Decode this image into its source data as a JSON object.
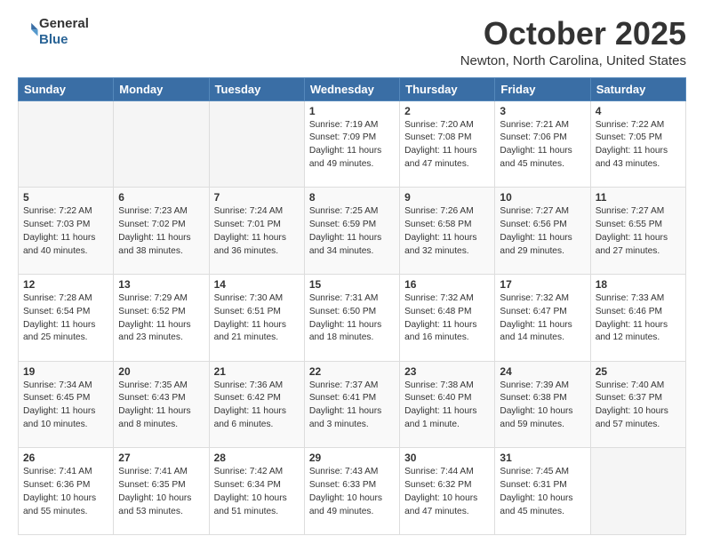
{
  "header": {
    "logo_general": "General",
    "logo_blue": "Blue",
    "month": "October 2025",
    "location": "Newton, North Carolina, United States"
  },
  "weekdays": [
    "Sunday",
    "Monday",
    "Tuesday",
    "Wednesday",
    "Thursday",
    "Friday",
    "Saturday"
  ],
  "weeks": [
    [
      {
        "day": "",
        "info": ""
      },
      {
        "day": "",
        "info": ""
      },
      {
        "day": "",
        "info": ""
      },
      {
        "day": "1",
        "info": "Sunrise: 7:19 AM\nSunset: 7:09 PM\nDaylight: 11 hours\nand 49 minutes."
      },
      {
        "day": "2",
        "info": "Sunrise: 7:20 AM\nSunset: 7:08 PM\nDaylight: 11 hours\nand 47 minutes."
      },
      {
        "day": "3",
        "info": "Sunrise: 7:21 AM\nSunset: 7:06 PM\nDaylight: 11 hours\nand 45 minutes."
      },
      {
        "day": "4",
        "info": "Sunrise: 7:22 AM\nSunset: 7:05 PM\nDaylight: 11 hours\nand 43 minutes."
      }
    ],
    [
      {
        "day": "5",
        "info": "Sunrise: 7:22 AM\nSunset: 7:03 PM\nDaylight: 11 hours\nand 40 minutes."
      },
      {
        "day": "6",
        "info": "Sunrise: 7:23 AM\nSunset: 7:02 PM\nDaylight: 11 hours\nand 38 minutes."
      },
      {
        "day": "7",
        "info": "Sunrise: 7:24 AM\nSunset: 7:01 PM\nDaylight: 11 hours\nand 36 minutes."
      },
      {
        "day": "8",
        "info": "Sunrise: 7:25 AM\nSunset: 6:59 PM\nDaylight: 11 hours\nand 34 minutes."
      },
      {
        "day": "9",
        "info": "Sunrise: 7:26 AM\nSunset: 6:58 PM\nDaylight: 11 hours\nand 32 minutes."
      },
      {
        "day": "10",
        "info": "Sunrise: 7:27 AM\nSunset: 6:56 PM\nDaylight: 11 hours\nand 29 minutes."
      },
      {
        "day": "11",
        "info": "Sunrise: 7:27 AM\nSunset: 6:55 PM\nDaylight: 11 hours\nand 27 minutes."
      }
    ],
    [
      {
        "day": "12",
        "info": "Sunrise: 7:28 AM\nSunset: 6:54 PM\nDaylight: 11 hours\nand 25 minutes."
      },
      {
        "day": "13",
        "info": "Sunrise: 7:29 AM\nSunset: 6:52 PM\nDaylight: 11 hours\nand 23 minutes."
      },
      {
        "day": "14",
        "info": "Sunrise: 7:30 AM\nSunset: 6:51 PM\nDaylight: 11 hours\nand 21 minutes."
      },
      {
        "day": "15",
        "info": "Sunrise: 7:31 AM\nSunset: 6:50 PM\nDaylight: 11 hours\nand 18 minutes."
      },
      {
        "day": "16",
        "info": "Sunrise: 7:32 AM\nSunset: 6:48 PM\nDaylight: 11 hours\nand 16 minutes."
      },
      {
        "day": "17",
        "info": "Sunrise: 7:32 AM\nSunset: 6:47 PM\nDaylight: 11 hours\nand 14 minutes."
      },
      {
        "day": "18",
        "info": "Sunrise: 7:33 AM\nSunset: 6:46 PM\nDaylight: 11 hours\nand 12 minutes."
      }
    ],
    [
      {
        "day": "19",
        "info": "Sunrise: 7:34 AM\nSunset: 6:45 PM\nDaylight: 11 hours\nand 10 minutes."
      },
      {
        "day": "20",
        "info": "Sunrise: 7:35 AM\nSunset: 6:43 PM\nDaylight: 11 hours\nand 8 minutes."
      },
      {
        "day": "21",
        "info": "Sunrise: 7:36 AM\nSunset: 6:42 PM\nDaylight: 11 hours\nand 6 minutes."
      },
      {
        "day": "22",
        "info": "Sunrise: 7:37 AM\nSunset: 6:41 PM\nDaylight: 11 hours\nand 3 minutes."
      },
      {
        "day": "23",
        "info": "Sunrise: 7:38 AM\nSunset: 6:40 PM\nDaylight: 11 hours\nand 1 minute."
      },
      {
        "day": "24",
        "info": "Sunrise: 7:39 AM\nSunset: 6:38 PM\nDaylight: 10 hours\nand 59 minutes."
      },
      {
        "day": "25",
        "info": "Sunrise: 7:40 AM\nSunset: 6:37 PM\nDaylight: 10 hours\nand 57 minutes."
      }
    ],
    [
      {
        "day": "26",
        "info": "Sunrise: 7:41 AM\nSunset: 6:36 PM\nDaylight: 10 hours\nand 55 minutes."
      },
      {
        "day": "27",
        "info": "Sunrise: 7:41 AM\nSunset: 6:35 PM\nDaylight: 10 hours\nand 53 minutes."
      },
      {
        "day": "28",
        "info": "Sunrise: 7:42 AM\nSunset: 6:34 PM\nDaylight: 10 hours\nand 51 minutes."
      },
      {
        "day": "29",
        "info": "Sunrise: 7:43 AM\nSunset: 6:33 PM\nDaylight: 10 hours\nand 49 minutes."
      },
      {
        "day": "30",
        "info": "Sunrise: 7:44 AM\nSunset: 6:32 PM\nDaylight: 10 hours\nand 47 minutes."
      },
      {
        "day": "31",
        "info": "Sunrise: 7:45 AM\nSunset: 6:31 PM\nDaylight: 10 hours\nand 45 minutes."
      },
      {
        "day": "",
        "info": ""
      }
    ]
  ]
}
